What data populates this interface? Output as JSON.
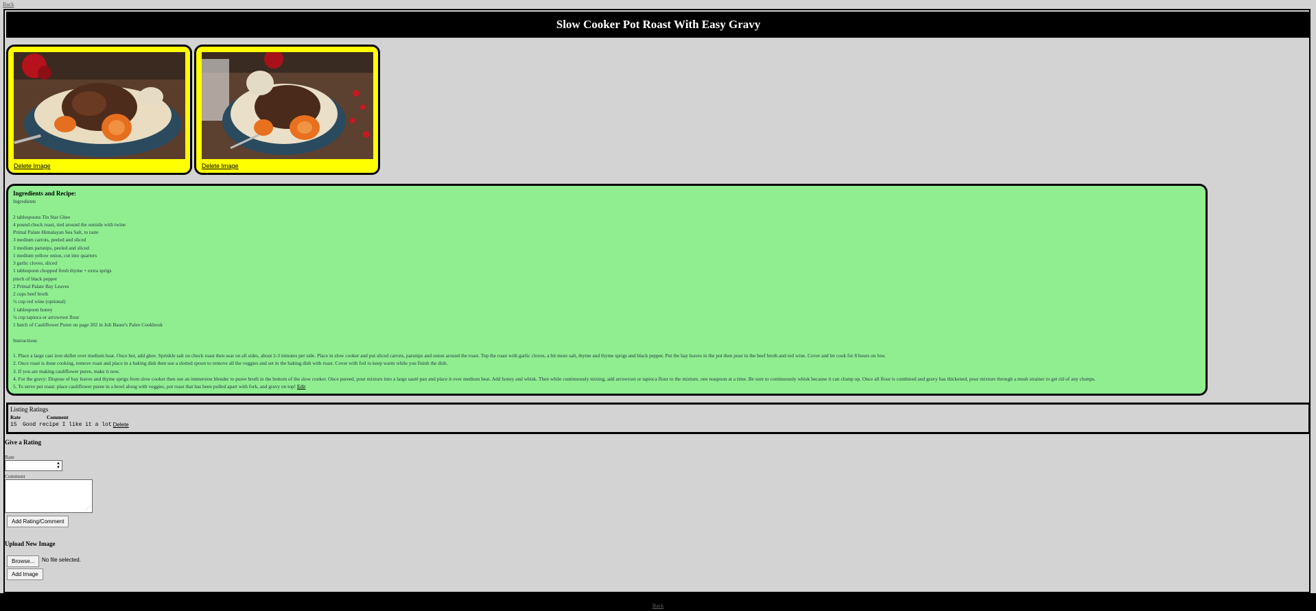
{
  "nav": {
    "back_label": "Back"
  },
  "title": "Slow Cooker Pot Roast With Easy Gravy",
  "images": [
    {
      "delete_label": "Delete Image"
    },
    {
      "delete_label": "Delete Image"
    }
  ],
  "recipe": {
    "heading": "Ingredients and Recipe:",
    "lines": [
      "Ingredients",
      "",
      "2 tablespoons Tin Star Ghee",
      "4 pound chuck roast, tied around the outside with twine",
      "Primal Palate Himalayan Sea Salt, to taste",
      "3 medium carrots, peeled and sliced",
      "3 medium parsnips, peeled and sliced",
      "1 medium yellow onion, cut into quarters",
      "3 garlic cloves, sliced",
      "1 tablespoon chopped fresh thyme + extra sprigs",
      "pinch of black pepper",
      "2 Primal Palate Bay Leaves",
      "2 cups beef broth",
      "½ cup red wine (optional)",
      "1 tablespoon honey",
      "¼ cup tapioca or arrowroot flour",
      "1 batch of Cauliflower Puree on page 202 in Juli Bauer's Paleo Cookbook",
      "",
      "Instructions",
      "",
      "1. Place a large cast iron skillet over medium heat. Once hot, add ghee. Sprinkle salt on chuck roast then sear on all sides, about 2-3 minutes per side. Place in slow cooker and put sliced carrots, parsnips and onion around the roast. Top the roast with garlic cloves, a bit more salt, thyme and thyme sprigs and black pepper. Put the bay leaves in the pot then pour in the beef broth and red wine. Cover and let cook for 8 hours on low.",
      "2. Once roast is done cooking, remove roast and place in a baking dish then use a slotted spoon to remove all the veggies and set in the baking dish with roast. Cover with foil to keep warm while you finish the dish.",
      "3. If you are making cauliflower puree, make it now.",
      "4. For the gravy: Dispose of bay leaves and thyme sprigs from slow cooker then use an immersion blender to puree broth in the bottom of the slow cooker. Once pureed, pour mixture into a large sauté pan and place it over medium heat. Add honey and whisk. Then while continuously mixing, add arrowroot or tapioca flour to the mixture, one teaspoon at a time. Be sure to continuously whisk because it can clump up. Once all flour is combined and gravy has thickened, pour mixture through a mesh strainer to get rid of any clumps."
    ],
    "last_line": "5. To serve pot roast: place cauliflower puree in a bowl along with veggies, pot roast that has been pulled apart with fork, and gravy on top!",
    "edit_label": "Edit"
  },
  "ratings": {
    "title": "Listing Ratings",
    "col_rate": "Rate",
    "col_comment": "Comment",
    "rows": [
      {
        "rate": "15",
        "comment": "Good recipe I like it a lot",
        "delete_label": "Delete"
      }
    ]
  },
  "give_rating": {
    "title": "Give a Rating",
    "rate_label": "Rate",
    "rate_value": "",
    "comment_label": "Comment",
    "comment_value": "",
    "submit_label": "Add Rating/Comment"
  },
  "upload": {
    "title": "Upload New Image",
    "browse_label": "Browse...",
    "no_file_text": "No file selected.",
    "submit_label": "Add Image"
  },
  "colors": {
    "page_bg": "#d3d3d3",
    "image_card_bg": "#ffff00",
    "recipe_bg": "#90ee90",
    "title_bar_bg": "#000000"
  }
}
